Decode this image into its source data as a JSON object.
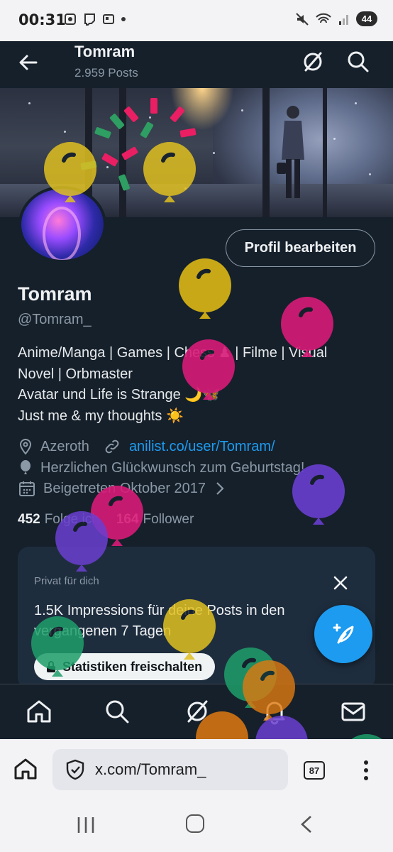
{
  "statusbar": {
    "time": "00:31",
    "battery": "44"
  },
  "header": {
    "title": "Tomram",
    "subtitle": "2.959 Posts"
  },
  "profile": {
    "edit_button": "Profil bearbeiten",
    "name": "Tomram",
    "handle": "@Tomram_",
    "bio_lines": [
      "Anime/Manga | Games | Chess ♟ | Filme | Visual",
      "Novel | Orbmaster",
      "Avatar und Life is Strange 🌙🦋",
      "Just me & my thoughts ☀️"
    ],
    "location": "Azeroth",
    "website": "anilist.co/user/Tomram/",
    "birthday": "Herzlichen Glückwunsch zum Geburtstag!",
    "joined": "Beigetreten Oktober 2017",
    "following_count": "452",
    "following_label": "Folge ich",
    "followers_count": "164",
    "followers_label": "Follower"
  },
  "card": {
    "label": "Privat für dich",
    "headline": "1.5K Impressions für deine Posts in den vergangenen 7 Tagen",
    "button": "Statistiken freischalten"
  },
  "browser": {
    "url": "x.com/Tomram_",
    "tab_count": "87"
  },
  "colors": {
    "background": "#15202b",
    "accent": "#1d9bf0",
    "card": "#1e2d3e",
    "muted": "#8b98a5"
  },
  "icons": {
    "header": [
      "back-arrow-icon",
      "grok-icon",
      "search-icon"
    ],
    "meta": [
      "location-icon",
      "link-icon",
      "balloon-icon",
      "calendar-icon",
      "chevron-right-icon"
    ],
    "nav": [
      "home-icon",
      "search-icon",
      "grok-icon",
      "notifications-icon",
      "messages-icon"
    ],
    "browser": [
      "home-icon",
      "shield-icon",
      "more-icon"
    ]
  }
}
